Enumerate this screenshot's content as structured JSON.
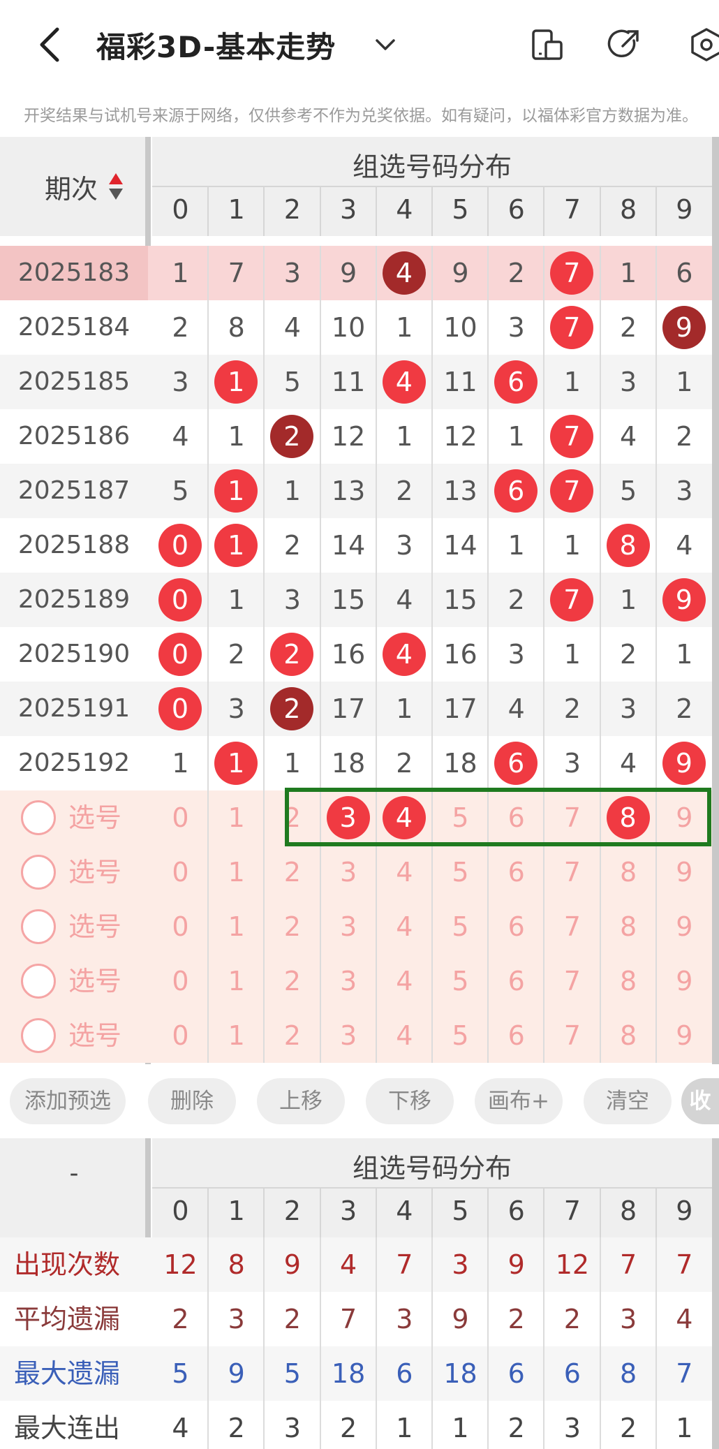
{
  "header": {
    "title": "福彩3D-基本走势",
    "notice": "开奖结果与试机号来源于网络，仅供参考不作为兑奖依据。如有疑问，以福体彩官方数据为准。"
  },
  "table": {
    "period_label": "期次",
    "group_label": "组选号码分布",
    "digits": [
      "0",
      "1",
      "2",
      "3",
      "4",
      "5",
      "6",
      "7",
      "8",
      "9"
    ],
    "rows": [
      {
        "period": "2025183",
        "highlighted": true,
        "cells": [
          {
            "v": "1"
          },
          {
            "v": "7"
          },
          {
            "v": "3"
          },
          {
            "v": "9"
          },
          {
            "v": "4",
            "ball": "dark"
          },
          {
            "v": "9"
          },
          {
            "v": "2"
          },
          {
            "v": "7",
            "ball": "red"
          },
          {
            "v": "1"
          },
          {
            "v": "6"
          }
        ]
      },
      {
        "period": "2025184",
        "cells": [
          {
            "v": "2"
          },
          {
            "v": "8"
          },
          {
            "v": "4"
          },
          {
            "v": "10"
          },
          {
            "v": "1"
          },
          {
            "v": "10"
          },
          {
            "v": "3"
          },
          {
            "v": "7",
            "ball": "red"
          },
          {
            "v": "2"
          },
          {
            "v": "9",
            "ball": "dark"
          }
        ]
      },
      {
        "period": "2025185",
        "cells": [
          {
            "v": "3"
          },
          {
            "v": "1",
            "ball": "red"
          },
          {
            "v": "5"
          },
          {
            "v": "11"
          },
          {
            "v": "4",
            "ball": "red"
          },
          {
            "v": "11"
          },
          {
            "v": "6",
            "ball": "red"
          },
          {
            "v": "1"
          },
          {
            "v": "3"
          },
          {
            "v": "1"
          }
        ]
      },
      {
        "period": "2025186",
        "cells": [
          {
            "v": "4"
          },
          {
            "v": "1"
          },
          {
            "v": "2",
            "ball": "dark"
          },
          {
            "v": "12"
          },
          {
            "v": "1"
          },
          {
            "v": "12"
          },
          {
            "v": "1"
          },
          {
            "v": "7",
            "ball": "red"
          },
          {
            "v": "4"
          },
          {
            "v": "2"
          }
        ]
      },
      {
        "period": "2025187",
        "cells": [
          {
            "v": "5"
          },
          {
            "v": "1",
            "ball": "red"
          },
          {
            "v": "1"
          },
          {
            "v": "13"
          },
          {
            "v": "2"
          },
          {
            "v": "13"
          },
          {
            "v": "6",
            "ball": "red"
          },
          {
            "v": "7",
            "ball": "red"
          },
          {
            "v": "5"
          },
          {
            "v": "3"
          }
        ]
      },
      {
        "period": "2025188",
        "cells": [
          {
            "v": "0",
            "ball": "red"
          },
          {
            "v": "1",
            "ball": "red"
          },
          {
            "v": "2"
          },
          {
            "v": "14"
          },
          {
            "v": "3"
          },
          {
            "v": "14"
          },
          {
            "v": "1"
          },
          {
            "v": "1"
          },
          {
            "v": "8",
            "ball": "red"
          },
          {
            "v": "4"
          }
        ]
      },
      {
        "period": "2025189",
        "cells": [
          {
            "v": "0",
            "ball": "red"
          },
          {
            "v": "1"
          },
          {
            "v": "3"
          },
          {
            "v": "15"
          },
          {
            "v": "4"
          },
          {
            "v": "15"
          },
          {
            "v": "2"
          },
          {
            "v": "7",
            "ball": "red"
          },
          {
            "v": "1"
          },
          {
            "v": "9",
            "ball": "red"
          }
        ]
      },
      {
        "period": "2025190",
        "cells": [
          {
            "v": "0",
            "ball": "red"
          },
          {
            "v": "2"
          },
          {
            "v": "2",
            "ball": "red"
          },
          {
            "v": "16"
          },
          {
            "v": "4",
            "ball": "red"
          },
          {
            "v": "16"
          },
          {
            "v": "3"
          },
          {
            "v": "1"
          },
          {
            "v": "2"
          },
          {
            "v": "1"
          }
        ]
      },
      {
        "period": "2025191",
        "cells": [
          {
            "v": "0",
            "ball": "red"
          },
          {
            "v": "3"
          },
          {
            "v": "2",
            "ball": "dark"
          },
          {
            "v": "17"
          },
          {
            "v": "1"
          },
          {
            "v": "17"
          },
          {
            "v": "4"
          },
          {
            "v": "2"
          },
          {
            "v": "3"
          },
          {
            "v": "2"
          }
        ]
      },
      {
        "period": "2025192",
        "cells": [
          {
            "v": "1"
          },
          {
            "v": "1",
            "ball": "red"
          },
          {
            "v": "1"
          },
          {
            "v": "18"
          },
          {
            "v": "2"
          },
          {
            "v": "18"
          },
          {
            "v": "6",
            "ball": "red"
          },
          {
            "v": "3"
          },
          {
            "v": "4"
          },
          {
            "v": "9",
            "ball": "red"
          }
        ]
      }
    ],
    "select_label": "选号",
    "select_rows": [
      {
        "selected": [
          "3",
          "4",
          "8"
        ]
      },
      {
        "selected": []
      },
      {
        "selected": []
      },
      {
        "selected": []
      },
      {
        "selected": []
      }
    ]
  },
  "toolbar": {
    "buttons": [
      "添加预选",
      "删除",
      "上移",
      "下移",
      "画布+",
      "清空"
    ],
    "collapse": "收"
  },
  "stats": {
    "left_head": "-",
    "group_label": "组选号码分布",
    "rows": [
      {
        "label": "出现次数",
        "color": "#b02a2a",
        "values": [
          "12",
          "8",
          "9",
          "4",
          "7",
          "3",
          "9",
          "12",
          "7",
          "7"
        ]
      },
      {
        "label": "平均遗漏",
        "color": "#8a3a3a",
        "values": [
          "2",
          "3",
          "2",
          "7",
          "3",
          "9",
          "2",
          "2",
          "3",
          "4"
        ]
      },
      {
        "label": "最大遗漏",
        "color": "#3a5fb8",
        "values": [
          "5",
          "9",
          "5",
          "18",
          "6",
          "18",
          "6",
          "6",
          "8",
          "7"
        ]
      },
      {
        "label": "最大连出",
        "color": "#444444",
        "values": [
          "4",
          "2",
          "3",
          "2",
          "1",
          "1",
          "2",
          "3",
          "2",
          "1"
        ]
      }
    ]
  },
  "colors": {
    "ball_red": "#f03a42",
    "ball_dark": "#a32a2a",
    "highlight_box": "#1f7a1f",
    "select_bg": "#fdece6"
  }
}
